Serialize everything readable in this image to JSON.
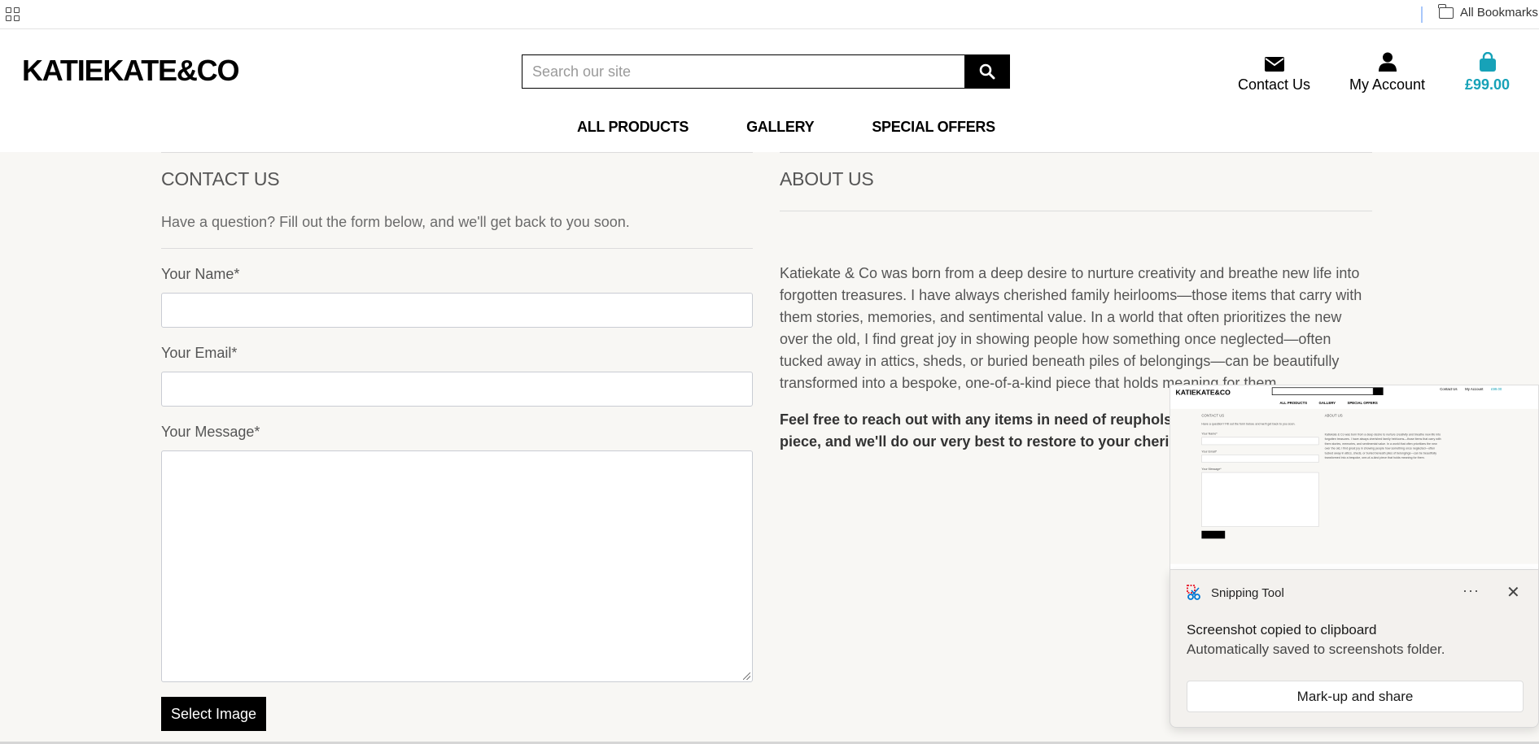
{
  "browser": {
    "bookmarks_label": "All Bookmarks"
  },
  "header": {
    "logo": "KATIEKATE&CO",
    "search_placeholder": "Search our site",
    "contact_label": "Contact Us",
    "account_label": "My Account",
    "cart_total": "£99.00",
    "nav": [
      "ALL PRODUCTS",
      "GALLERY",
      "SPECIAL OFFERS"
    ]
  },
  "contact": {
    "title": "CONTACT US",
    "intro": "Have a question? Fill out the form below, and we'll get back to you soon.",
    "name_label": "Your Name*",
    "email_label": "Your Email*",
    "message_label": "Your Message*",
    "select_image_label": "Select Image"
  },
  "about": {
    "title": "ABOUT US",
    "paragraph": "Katiekate & Co was born from a deep desire to nurture creativity and breathe new life into forgotten treasures. I have always cherished family heirlooms—those items that carry with them stories, memories, and sentimental value. In a world that often prioritizes the new over the old, I find great joy in showing people how something once neglected—often tucked away in attics, sheds, or buried beneath piles of belongings—can be beautifully transformed into a bespoke, one-of-a-kind piece that holds meaning for them.",
    "cta": "Feel free to reach out with any items in need of reupholstery! your vision for the piece, and we'll do our very best to restore to your cherished items."
  },
  "snipping_toast": {
    "app_name": "Snipping Tool",
    "title": "Screenshot copied to clipboard",
    "subtitle": "Automatically saved to screenshots folder.",
    "action_label": "Mark-up and share",
    "more_label": "···",
    "close_label": "✕"
  },
  "colors": {
    "accent": "#17a2b8",
    "page_background": "#f8f7f4",
    "button_black": "#000000"
  }
}
